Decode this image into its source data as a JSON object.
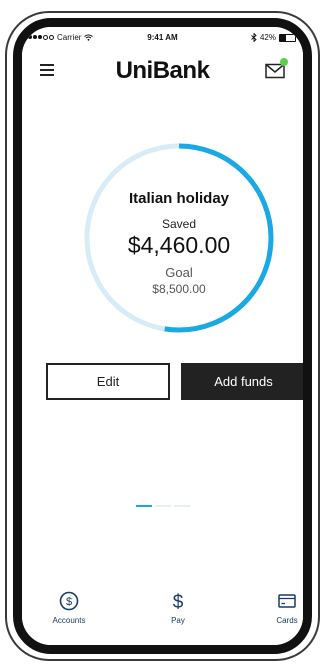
{
  "status_bar": {
    "carrier": "Carrier",
    "time": "9:41 AM",
    "battery_percent": "42%",
    "battery_level": 0.42
  },
  "header": {
    "logo": "UniBank",
    "menu_icon": "hamburger-menu-icon",
    "mail_icon": "mail-icon",
    "mail_badge_color": "#55d24a"
  },
  "goal": {
    "name": "Italian holiday",
    "saved_label": "Saved",
    "saved_amount": "$4,460.00",
    "goal_label": "Goal",
    "goal_amount": "$8,500.00",
    "progress": 0.5247,
    "progress_color": "#1aa9e5",
    "track_color": "#d8ecf8"
  },
  "actions": {
    "edit_label": "Edit",
    "add_funds_label": "Add funds"
  },
  "pager": {
    "pages": 3,
    "active_index": 0
  },
  "tabbar": {
    "accent_color": "#1a3b66",
    "tabs": [
      {
        "label": "Accounts",
        "icon": "dollar-circle-icon"
      },
      {
        "label": "Pay",
        "icon": "dollar-sign-icon"
      },
      {
        "label": "Cards",
        "icon": "credit-card-icon"
      }
    ]
  }
}
